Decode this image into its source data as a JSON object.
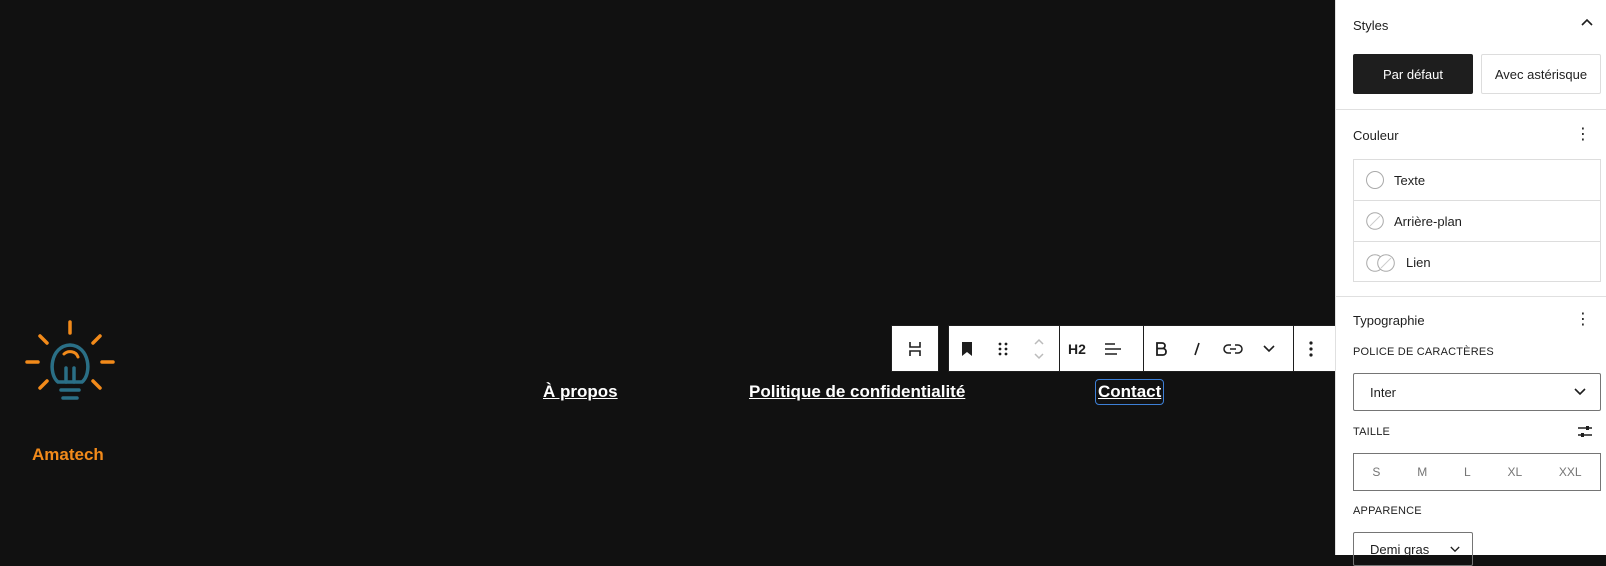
{
  "canvas": {
    "brand": "Amatech",
    "nav": [
      "À propos",
      "Politique de confidentialité",
      "Contact"
    ],
    "colors": {
      "bg": "#111111",
      "brand": "#f28a1a",
      "logo_bulb": "#2a6f86",
      "selection": "#3d7fd6"
    }
  },
  "toolbar": {
    "heading_level": "H2"
  },
  "sidebar": {
    "styles": {
      "title": "Styles",
      "default": "Par défaut",
      "asterisk": "Avec astérisque"
    },
    "color": {
      "title": "Couleur",
      "items": [
        "Texte",
        "Arrière-plan",
        "Lien"
      ]
    },
    "typography": {
      "title": "Typographie",
      "font_label": "POLICE DE CARACTÈRES",
      "font_value": "Inter",
      "size_label": "TAILLE",
      "sizes": [
        "S",
        "M",
        "L",
        "XL",
        "XXL"
      ],
      "appearance_label": "APPARENCE",
      "appearance_value": "Demi gras"
    }
  }
}
